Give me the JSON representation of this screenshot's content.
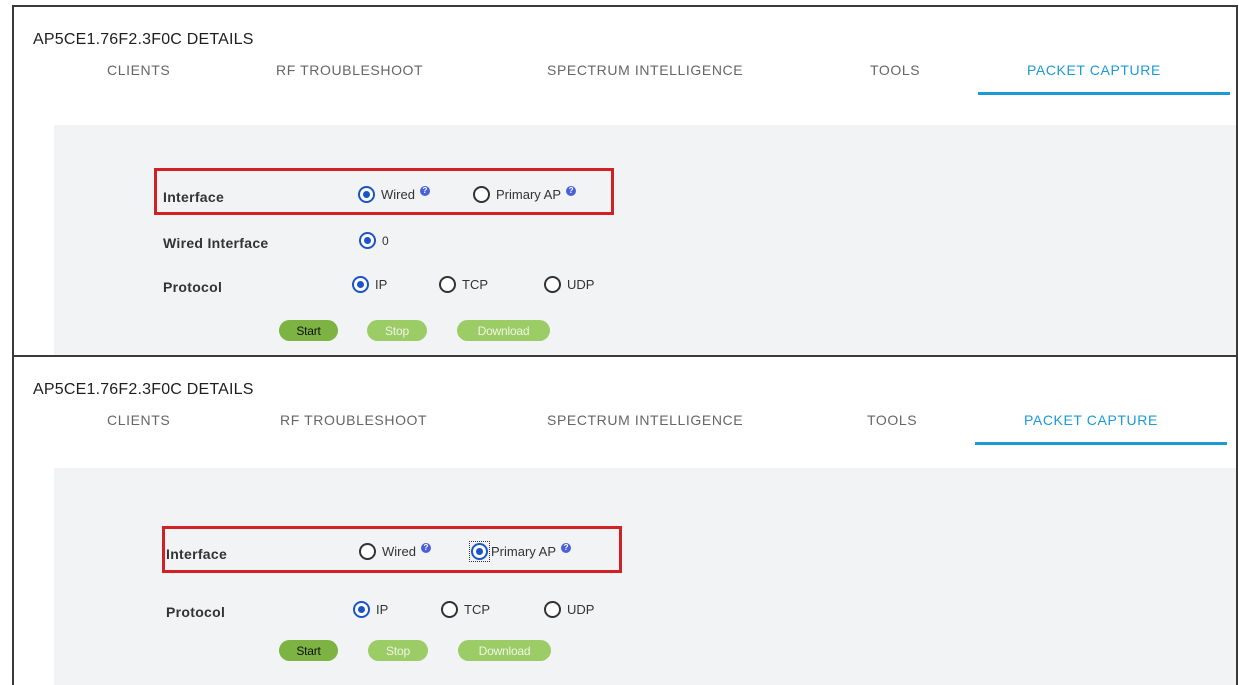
{
  "panels": [
    {
      "title": "AP5CE1.76F2.3F0C  DETAILS",
      "tabs": [
        "CLIENTS",
        "RF TROUBLESHOOT",
        "SPECTRUM INTELLIGENCE",
        "TOOLS",
        "PACKET CAPTURE"
      ],
      "active_tab": "PACKET CAPTURE",
      "interface_label": "Interface",
      "interface_options": [
        "Wired",
        "Primary AP"
      ],
      "interface_selected": "Wired",
      "help_icon": "?",
      "wired_interface_label": "Wired Interface",
      "wired_interface_value": "0",
      "protocol_label": "Protocol",
      "protocol_options": [
        "IP",
        "TCP",
        "UDP"
      ],
      "protocol_selected": "IP",
      "buttons": {
        "start": "Start",
        "stop": "Stop",
        "download": "Download"
      }
    },
    {
      "title": "AP5CE1.76F2.3F0C  DETAILS",
      "tabs": [
        "CLIENTS",
        "RF TROUBLESHOOT",
        "SPECTRUM INTELLIGENCE",
        "TOOLS",
        "PACKET CAPTURE"
      ],
      "active_tab": "PACKET CAPTURE",
      "interface_label": "Interface",
      "interface_options": [
        "Wired",
        "Primary AP"
      ],
      "interface_selected": "Primary AP",
      "help_icon": "?",
      "protocol_label": "Protocol",
      "protocol_options": [
        "IP",
        "TCP",
        "UDP"
      ],
      "protocol_selected": "IP",
      "buttons": {
        "start": "Start",
        "stop": "Stop",
        "download": "Download"
      }
    }
  ],
  "colors": {
    "accent": "#1c9ad6",
    "radio_selected": "#1a55c8",
    "highlight_box": "#d32027",
    "start_button": "#7cb342",
    "disabled_button": "#9ccc65",
    "help_icon": "#4b5fd6"
  }
}
